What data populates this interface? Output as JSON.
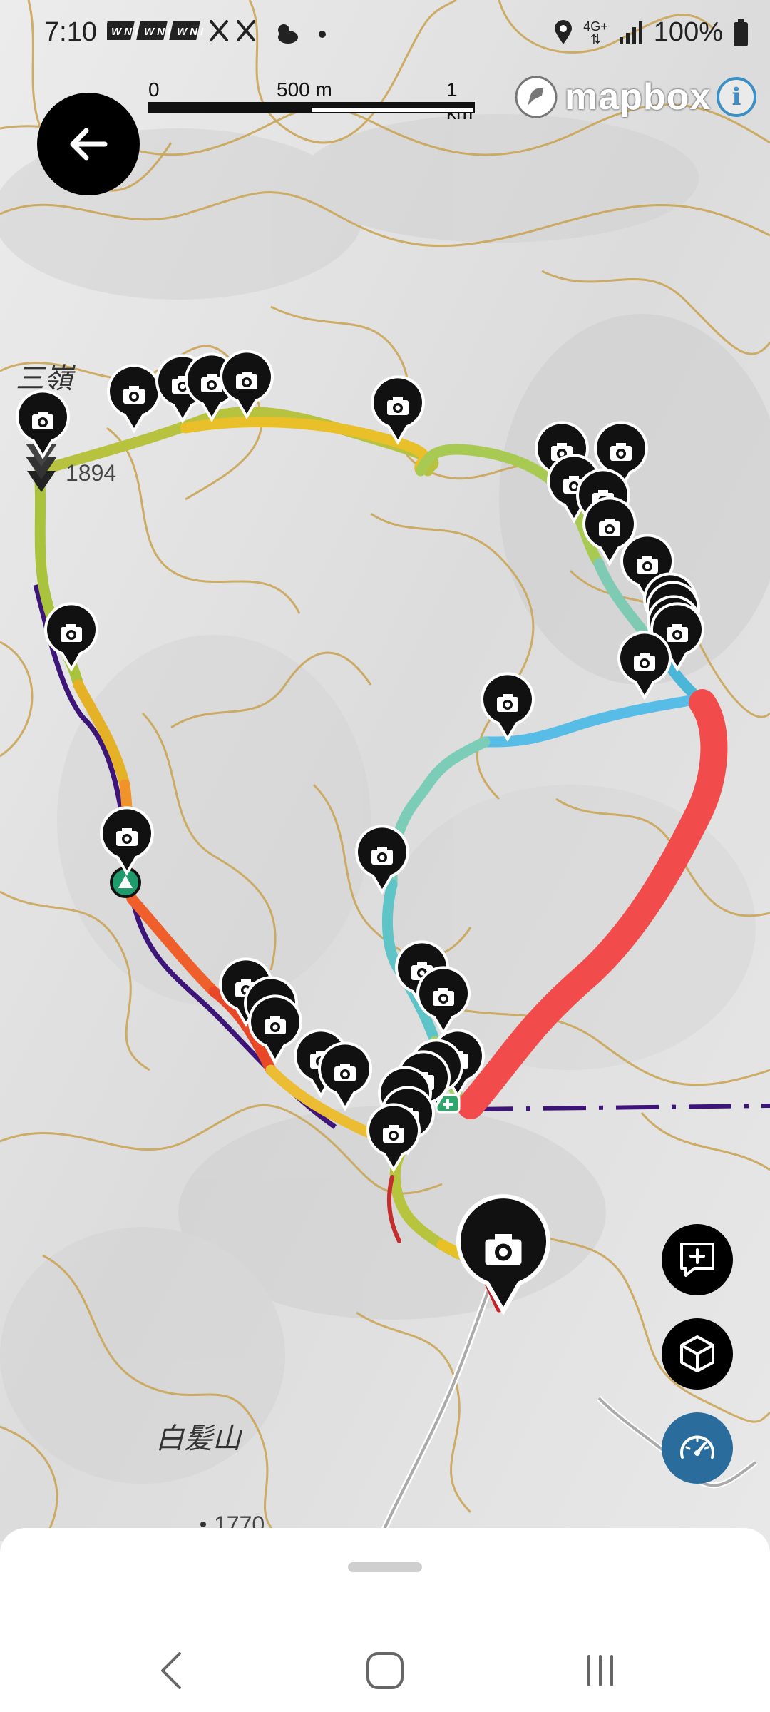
{
  "status_bar": {
    "time": "7:10",
    "notification_icons": [
      "wni-icon",
      "wni-icon",
      "wni-icon",
      "crossed-tools-icon",
      "crossed-tools-icon",
      "cloud-sun-icon",
      "dot-icon"
    ],
    "network": "4G+",
    "battery": "100%"
  },
  "scale_bar": {
    "labels": [
      "0",
      "500 m",
      "1 km"
    ]
  },
  "attribution": {
    "logo_text": "mapbox",
    "info_label": "i"
  },
  "map_labels": {
    "peak_name": "三嶺",
    "peak_elevation": "1894",
    "mountain_name": "白髪山",
    "mountain_elevation": "1770"
  },
  "controls": {
    "back": "arrow-left-icon",
    "add_note": "add-note-icon",
    "view_3d": "cube-icon",
    "speed": "speedometer-icon"
  },
  "colors": {
    "contour": "#c9a24f",
    "route_red": "#f24b4b",
    "trail_dashed": "#3d1478",
    "marker": "#111111",
    "speed_button": "#2a6d9c"
  },
  "nav_bar": [
    "back-nav-icon",
    "home-nav-icon",
    "recents-nav-icon"
  ]
}
